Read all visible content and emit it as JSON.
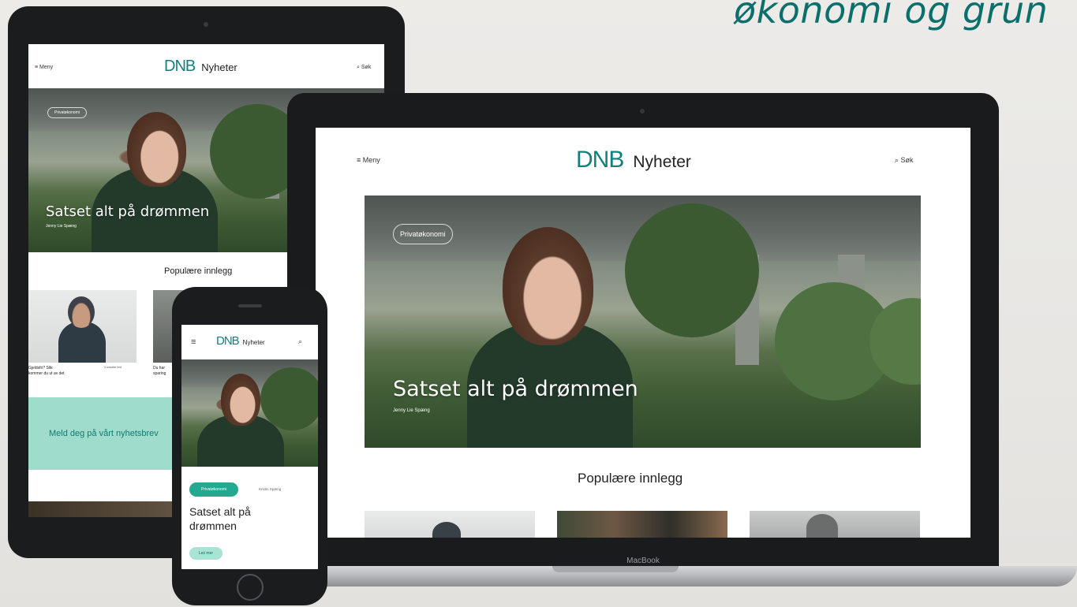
{
  "tagline": "økonomi og grun",
  "site": {
    "logo_mark": "DNB",
    "logo_name": "Nyheter",
    "menu_label": "Meny",
    "search_label": "Søk",
    "menu_icon": "hamburger-icon",
    "search_icon": "search-icon"
  },
  "hero": {
    "category": "Privatøkonomi",
    "title": "Satset alt på drømmen",
    "byline": "Jenny Lie Spæng",
    "laptop_byline": "Jenny Lie Spæng"
  },
  "popular": {
    "heading": "Populære innlegg"
  },
  "tablet_cards": [
    {
      "title_line1": "Gjeldsfri? Slik",
      "title_line2": "kommer du ut av det",
      "meta": "3 minutter lest"
    },
    {
      "title_line1": "Du har",
      "title_line2": "sparing",
      "meta": ""
    }
  ],
  "newsletter": {
    "label": "Meld deg på vårt nyhetsbrev"
  },
  "phone": {
    "category_button": "Privatøkonomi",
    "author": "Kristin Spæng",
    "title_line1": "Satset alt på",
    "title_line2": "drømmen",
    "read_button": "Les mer"
  },
  "laptop": {
    "brand": "MacBook"
  },
  "colors": {
    "brand_teal": "#14807d",
    "mint": "#9fdccc",
    "tagline": "#0b6f6c"
  }
}
